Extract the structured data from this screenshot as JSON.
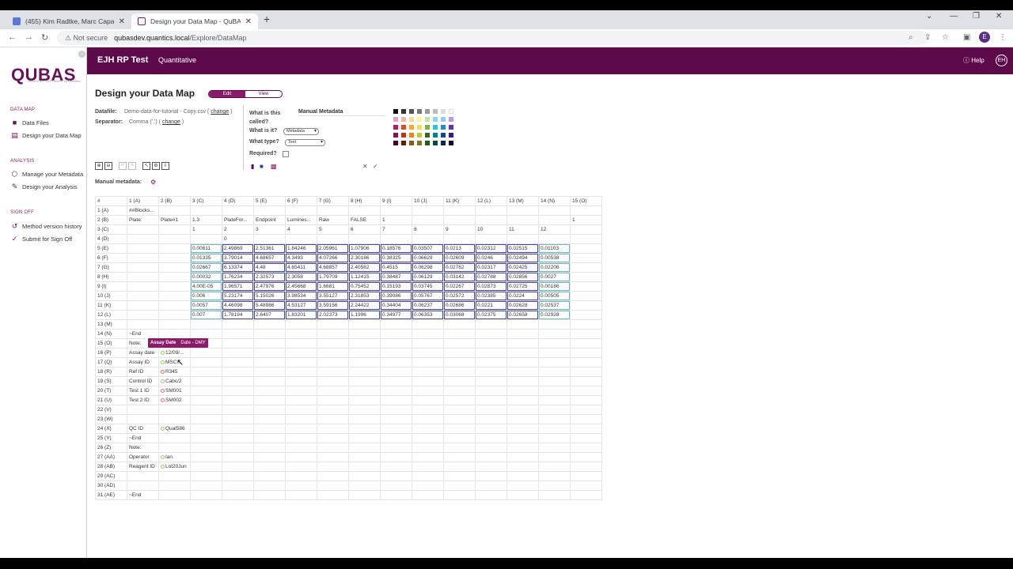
{
  "browser": {
    "tabs": [
      {
        "title": "(455) Kim Radtke, Marc Capavan...",
        "favicon_color": "#5b79d9",
        "active": false
      },
      {
        "title": "Design your Data Map - QuBAS ...",
        "favicon_color": "#8b1a6b",
        "active": true
      }
    ],
    "new_tab": "+",
    "not_secure": "Not secure",
    "url_host": "qubasdev.quantics.local",
    "url_path": "/Explore/DataMap",
    "profile_initial": "E"
  },
  "sidebar": {
    "logo": "QUBAS",
    "logo_sub": "BIOASSAY SOFTWARE by Quantics",
    "sections": [
      {
        "title": "DATA MAP",
        "items": [
          {
            "label": "Data Files",
            "icon": "folder-icon"
          },
          {
            "label": "Design your Data Map",
            "icon": "map-icon"
          }
        ]
      },
      {
        "title": "ANALYSIS",
        "items": [
          {
            "label": "Manage your Metadata",
            "icon": "cube-icon"
          },
          {
            "label": "Design your Analysis",
            "icon": "pencil-icon"
          }
        ]
      },
      {
        "title": "SIGN OFF",
        "items": [
          {
            "label": "Method version history",
            "icon": "history-icon"
          },
          {
            "label": "Submit for Sign Off",
            "icon": "check-circle-icon"
          }
        ]
      }
    ]
  },
  "appbar": {
    "project": "EJH RP Test",
    "mode": "Quantitative",
    "help": "Help",
    "user_initials": "EH",
    "color": "#5c0a4a"
  },
  "page": {
    "title": "Design your Data Map",
    "toggle": {
      "edit": "Edit",
      "view": "View"
    },
    "datafile_label": "Datafile:",
    "datafile_value": "Demo-data-for-tutorial - Copy.csv",
    "change": "change",
    "separator_label": "Separator:",
    "separator_value": "Comma (',')",
    "what_called_label": "What is this called?",
    "what_called_value": "Manual Metadata",
    "what_is_label": "What is it?",
    "what_is_value": "Metadata",
    "what_type_label": "What type?",
    "what_type_value": "Text",
    "required_label": "Required?",
    "manual_metadata_label": "Manual metadata:"
  },
  "palette": [
    "#111111",
    "#333333",
    "#555555",
    "#777777",
    "#999999",
    "#bbbbbb",
    "#dddddd",
    "#ffffff",
    "#e6a0c4",
    "#f4b6a0",
    "#f9d89c",
    "#fff59d",
    "#c5e1a5",
    "#80deea",
    "#90caf9",
    "#b39ddb",
    "#c2185b",
    "#e64a19",
    "#f9a825",
    "#f0e442",
    "#7cb342",
    "#26c6da",
    "#1e88e5",
    "#5e35b1",
    "#880e4f",
    "#bf360c",
    "#f57f17",
    "#c0ca33",
    "#33691e",
    "#00838f",
    "#0d47a1",
    "#311b92",
    "#4a0026",
    "#6d1b00",
    "#8d5a00",
    "#827717",
    "#1b5e20",
    "#004d40",
    "#0a2463",
    "#1a0033"
  ],
  "grid": {
    "columns": [
      "#",
      "1 (A)",
      "2 (B)",
      "3 (C)",
      "4 (D)",
      "5 (E)",
      "6 (F)",
      "7 (G)",
      "8 (H)",
      "9 (I)",
      "10 (J)",
      "11 (K)",
      "12 (L)",
      "13 (M)",
      "14 (N)",
      "15 (O)"
    ],
    "rows": [
      [
        "1 (A)",
        "##Blocks...",
        "",
        "",
        "",
        "",
        "",
        "",
        "",
        "",
        "",
        "",
        "",
        "",
        "",
        ""
      ],
      [
        "2 (B)",
        "Plate:",
        "Plate#1",
        "1.3",
        "PlateFor...",
        "Endpoint",
        "Lumines...",
        "Raw",
        "FALSE",
        "1",
        "",
        "",
        "",
        "",
        "",
        "1"
      ],
      [
        "3 (C)",
        "",
        "",
        "1",
        "2",
        "3",
        "4",
        "5",
        "6",
        "7",
        "8",
        "9",
        "10",
        "11",
        "12",
        ""
      ],
      [
        "4 (D)",
        "",
        "",
        "",
        "0",
        "",
        "",
        "",
        "",
        "",
        "",
        "",
        "",
        "",
        "",
        ""
      ],
      [
        "5 (E)",
        "",
        "",
        "0.00611",
        "2.49869",
        "2.51361",
        "1.84246",
        "2.05961",
        "1.07906",
        "0.18576",
        "0.03507",
        "0.0213",
        "0.02312",
        "0.02515",
        "0.01103",
        ""
      ],
      [
        "6 (F)",
        "",
        "",
        "0.01335",
        "3.79014",
        "4.68657",
        "4.3493",
        "4.07266",
        "2.30186",
        "0.38325",
        "0.06629",
        "0.02609",
        "0.0246",
        "0.02494",
        "0.00538",
        ""
      ],
      [
        "7 (G)",
        "",
        "",
        "0.02667",
        "6.13374",
        "4.48",
        "4.65411",
        "4.68857",
        "2.40562",
        "0.4515",
        "0.06298",
        "0.02762",
        "0.02317",
        "0.02425",
        "0.02206",
        ""
      ],
      [
        "8 (H)",
        "",
        "",
        "0.00032",
        "1.76234",
        "2.32573",
        "2.3058",
        "1.79709",
        "1.12415",
        "0.38487",
        "0.06129",
        "0.03142",
        "0.02788",
        "0.02856",
        "0.0027",
        ""
      ],
      [
        "9 (I)",
        "",
        "",
        "4.00E-05",
        "1.96571",
        "2.47976",
        "2.45668",
        "1.6681",
        "0.75452",
        "0.15193",
        "0.03745",
        "0.02267",
        "0.02873",
        "0.02725",
        "0.00186",
        ""
      ],
      [
        "10 (J)",
        "",
        "",
        "0.006",
        "5.23174",
        "5.15026",
        "3.98534",
        "3.55127",
        "2.31853",
        "0.39086",
        "0.05767",
        "0.02572",
        "0.02385",
        "0.0224",
        "0.00505",
        ""
      ],
      [
        "11 (K)",
        "",
        "",
        "0.0057",
        "4.46098",
        "5.48986",
        "4.53127",
        "3.59156",
        "2.24422",
        "0.34404",
        "0.06237",
        "0.02686",
        "0.0221",
        "0.02628",
        "0.02537",
        ""
      ],
      [
        "12 (L)",
        "",
        "",
        "0.007",
        "1.78194",
        "2.6407",
        "1.83201",
        "2.02373",
        "1.1996",
        "0.34977",
        "0.06353",
        "0.03068",
        "0.02375",
        "0.02658",
        "0.02928",
        ""
      ],
      [
        "13 (M)",
        "",
        "",
        "",
        "",
        "",
        "",
        "",
        "",
        "",
        "",
        "",
        "",
        "",
        "",
        ""
      ],
      [
        "14 (N)",
        "~End",
        "",
        "",
        "",
        "",
        "",
        "",
        "",
        "",
        "",
        "",
        "",
        "",
        "",
        ""
      ],
      [
        "15 (O)",
        "Note:",
        "",
        "",
        "",
        "",
        "",
        "",
        "",
        "",
        "",
        "",
        "",
        "",
        "",
        ""
      ],
      [
        "16 (P)",
        "Assay date",
        "12/09/...",
        "",
        "",
        "",
        "",
        "",
        "",
        "",
        "",
        "",
        "",
        "",
        "",
        ""
      ],
      [
        "17 (Q)",
        "Assay ID",
        "MSC...",
        "",
        "",
        "",
        "",
        "",
        "",
        "",
        "",
        "",
        "",
        "",
        "",
        ""
      ],
      [
        "18 (R)",
        "Ref ID",
        "R345",
        "",
        "",
        "",
        "",
        "",
        "",
        "",
        "",
        "",
        "",
        "",
        "",
        ""
      ],
      [
        "19 (S)",
        "Control ID",
        "Cabc/2",
        "",
        "",
        "",
        "",
        "",
        "",
        "",
        "",
        "",
        "",
        "",
        "",
        ""
      ],
      [
        "20 (T)",
        "Test 1 ID",
        "SM001",
        "",
        "",
        "",
        "",
        "",
        "",
        "",
        "",
        "",
        "",
        "",
        "",
        ""
      ],
      [
        "21 (U)",
        "Test 2 ID",
        "SM002",
        "",
        "",
        "",
        "",
        "",
        "",
        "",
        "",
        "",
        "",
        "",
        "",
        ""
      ],
      [
        "22 (V)",
        "",
        "",
        "",
        "",
        "",
        "",
        "",
        "",
        "",
        "",
        "",
        "",
        "",
        "",
        ""
      ],
      [
        "23 (W)",
        "",
        "",
        "",
        "",
        "",
        "",
        "",
        "",
        "",
        "",
        "",
        "",
        "",
        "",
        ""
      ],
      [
        "24 (X)",
        "QC ID",
        "Qual586",
        "",
        "",
        "",
        "",
        "",
        "",
        "",
        "",
        "",
        "",
        "",
        "",
        ""
      ],
      [
        "25 (Y)",
        "~End",
        "",
        "",
        "",
        "",
        "",
        "",
        "",
        "",
        "",
        "",
        "",
        "",
        "",
        ""
      ],
      [
        "26 (Z)",
        "Note:",
        "",
        "",
        "",
        "",
        "",
        "",
        "",
        "",
        "",
        "",
        "",
        "",
        "",
        ""
      ],
      [
        "27 (AA)",
        "Operator",
        "Ian",
        "",
        "",
        "",
        "",
        "",
        "",
        "",
        "",
        "",
        "",
        "",
        "",
        ""
      ],
      [
        "28 (AB)",
        "Reagent ID",
        "Lot20Jun",
        "",
        "",
        "",
        "",
        "",
        "",
        "",
        "",
        "",
        "",
        "",
        "",
        ""
      ],
      [
        "29 (AC)",
        "",
        "",
        "",
        "",
        "",
        "",
        "",
        "",
        "",
        "",
        "",
        "",
        "",
        "",
        ""
      ],
      [
        "30 (AD)",
        "",
        "",
        "",
        "",
        "",
        "",
        "",
        "",
        "",
        "",
        "",
        "",
        "",
        "",
        ""
      ],
      [
        "31 (AE)",
        "~End",
        "",
        "",
        "",
        "",
        "",
        "",
        "",
        "",
        "",
        "",
        "",
        "",
        "",
        ""
      ]
    ],
    "dot_colors": {
      "16 (P)": "#9ccc65",
      "17 (Q)": "#9ccc65",
      "18 (R)": "#e57373",
      "19 (S)": "#9ccc65",
      "20 (T)": "#e57373",
      "21 (U)": "#e57373",
      "24 (X)": "#9ccc65",
      "27 (AA)": "#9ccc65",
      "28 (AB)": "#9ccc65"
    }
  },
  "tooltip": {
    "name": "Assay Date",
    "type": "Date - DMY"
  }
}
